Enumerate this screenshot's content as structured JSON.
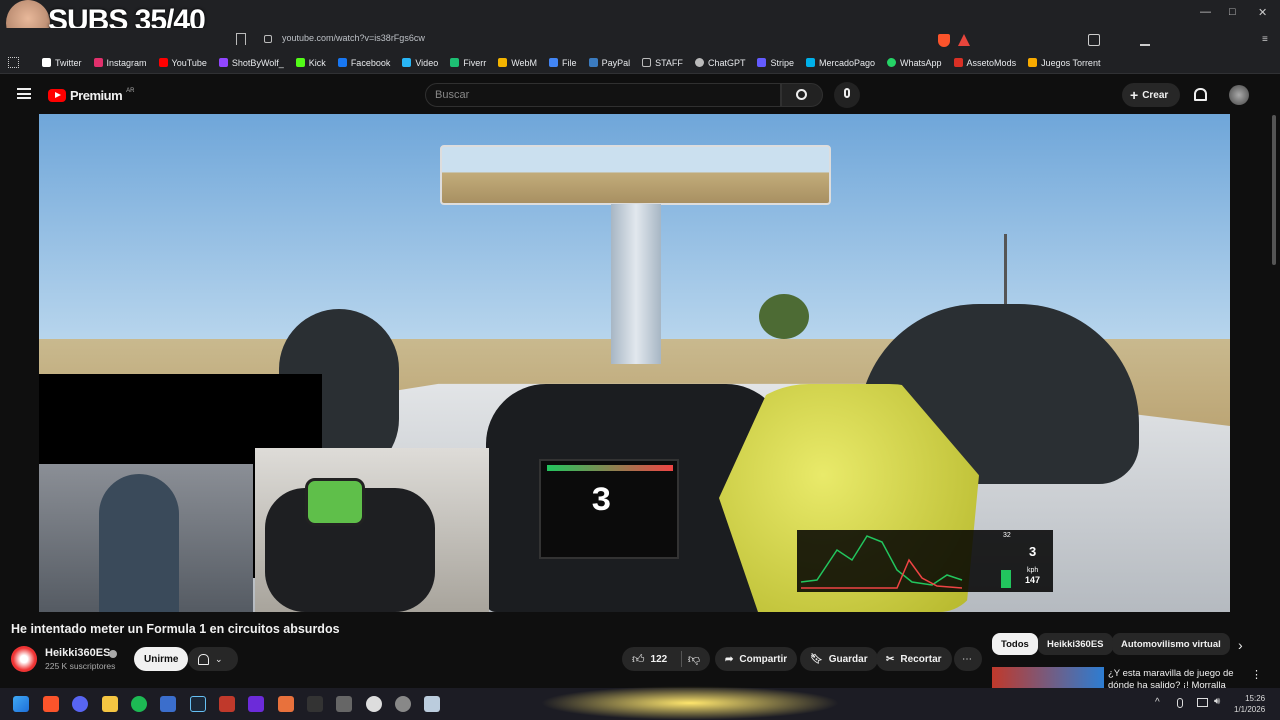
{
  "overlay": {
    "subs_counter": "SUBS 35/40"
  },
  "browser": {
    "url": "youtube.com/watch?v=is38rFgs6cw",
    "bookmarks": [
      {
        "label": "Twitter",
        "color": "#ffffff"
      },
      {
        "label": "Instagram",
        "color": "#e1306c"
      },
      {
        "label": "YouTube",
        "color": "#ff0000"
      },
      {
        "label": "ShotByWolf_",
        "color": "#9146ff"
      },
      {
        "label": "Kick",
        "color": "#53fc18"
      },
      {
        "label": "Facebook",
        "color": "#1877f2"
      },
      {
        "label": "Video",
        "color": "#29b6f6"
      },
      {
        "label": "Fiverr",
        "color": "#1dbf73"
      },
      {
        "label": "WebM",
        "color": "#f4b400"
      },
      {
        "label": "File",
        "color": "#4285f4"
      },
      {
        "label": "PayPal",
        "color": "#3b7bbf"
      },
      {
        "label": "STAFF",
        "color": "#bbbbbb"
      },
      {
        "label": "ChatGPT",
        "color": "#bbbbbb"
      },
      {
        "label": "Stripe",
        "color": "#635bff"
      },
      {
        "label": "MercadoPago",
        "color": "#00b1ea"
      },
      {
        "label": "WhatsApp",
        "color": "#25d366"
      },
      {
        "label": "AssetoMods",
        "color": "#d93025"
      },
      {
        "label": "Juegos Torrent",
        "color": "#f9ab00"
      }
    ]
  },
  "youtube": {
    "logo": "Premium",
    "region": "AR",
    "search_placeholder": "Buscar",
    "create_label": "Crear"
  },
  "video": {
    "title": "He intentado meter un Formula 1 en circuitos absurdos",
    "channel": "Heikki360ES",
    "subscribers": "225 K suscriptores",
    "join_label": "Unirme",
    "likes": "122",
    "share_label": "Compartir",
    "save_label": "Guardar",
    "clip_label": "Recortar",
    "hud": {
      "gear": "3",
      "speed_unit": "kph",
      "speed": "147",
      "lap_value": "32"
    }
  },
  "recommendations": {
    "chips": [
      "Todos",
      "Heikki360ES",
      "Automovilismo virtual"
    ],
    "first_title": "¿Y esta maravilla de juego de dónde ha salido? ¡! Morralla"
  },
  "taskbar": {
    "time": "15:26",
    "date": "1/1/2026"
  }
}
